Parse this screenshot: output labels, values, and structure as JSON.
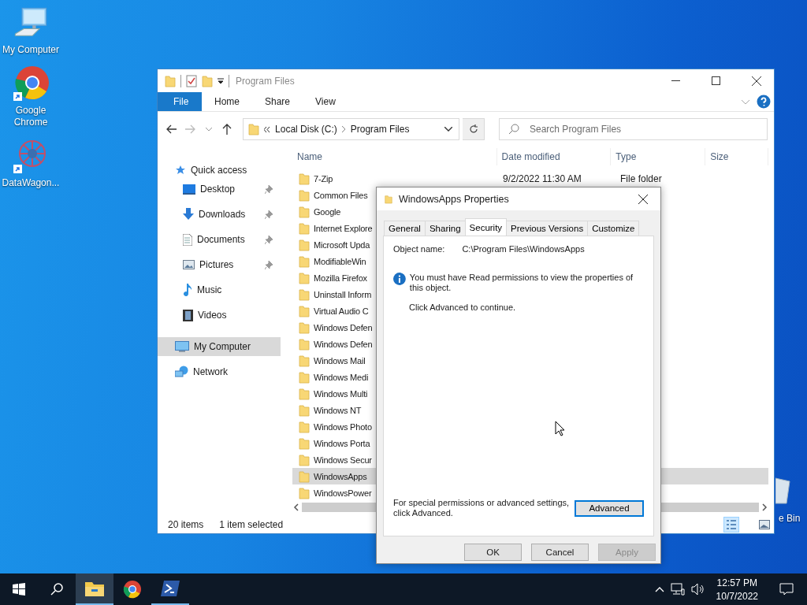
{
  "desktop_icons": [
    {
      "label": "My Computer",
      "kind": "computer"
    },
    {
      "label": "Google Chrome",
      "kind": "chrome"
    },
    {
      "label": "DataWagon...",
      "kind": "emblem"
    }
  ],
  "edge_icon": {
    "label": "e Bin",
    "kind": "bin"
  },
  "explorer": {
    "title": "Program Files",
    "ribbon_tabs": [
      {
        "label": "File",
        "kind": "file"
      },
      {
        "label": "Home",
        "kind": "tab"
      },
      {
        "label": "Share",
        "kind": "tab"
      },
      {
        "label": "View",
        "kind": "tab"
      }
    ],
    "address": [
      "Local Disk (C:)",
      "Program Files"
    ],
    "search": {
      "placeholder": "Search Program Files"
    },
    "nav": [
      {
        "label": "Quick access",
        "kind": "star",
        "selected": false,
        "children": [
          {
            "label": "Desktop",
            "kind": "desktop",
            "pinned": true,
            "selected": false
          },
          {
            "label": "Downloads",
            "kind": "download",
            "pinned": true,
            "selected": false
          },
          {
            "label": "Documents",
            "kind": "document",
            "pinned": true,
            "selected": false
          },
          {
            "label": "Pictures",
            "kind": "picture",
            "pinned": true,
            "selected": false
          },
          {
            "label": "Music",
            "kind": "music",
            "pinned": false,
            "selected": false
          },
          {
            "label": "Videos",
            "kind": "video",
            "pinned": false,
            "selected": false
          }
        ]
      },
      {
        "label": "My Computer",
        "kind": "computer",
        "selected": true
      },
      {
        "label": "Network",
        "kind": "network",
        "selected": false
      }
    ],
    "columns": [
      "Name",
      "Date modified",
      "Type",
      "Size"
    ],
    "rows": [
      {
        "name": "7-Zip",
        "date": "9/2/2022 11:30 AM",
        "type": "File folder",
        "selected": false
      },
      {
        "name": "Common Files",
        "selected": false
      },
      {
        "name": "Google",
        "selected": false
      },
      {
        "name": "Internet Explore",
        "selected": false
      },
      {
        "name": "Microsoft Upda",
        "selected": false
      },
      {
        "name": "ModifiableWin",
        "selected": false
      },
      {
        "name": "Mozilla Firefox",
        "selected": false
      },
      {
        "name": "Uninstall Inform",
        "selected": false
      },
      {
        "name": "Virtual Audio C",
        "selected": false
      },
      {
        "name": "Windows Defen",
        "selected": false
      },
      {
        "name": "Windows Defen",
        "selected": false
      },
      {
        "name": "Windows Mail",
        "selected": false
      },
      {
        "name": "Windows Medi",
        "selected": false
      },
      {
        "name": "Windows Multi",
        "selected": false
      },
      {
        "name": "Windows NT",
        "selected": false
      },
      {
        "name": "Windows Photo",
        "selected": false
      },
      {
        "name": "Windows Porta",
        "selected": false
      },
      {
        "name": "Windows Secur",
        "selected": false
      },
      {
        "name": "WindowsApps",
        "selected": true
      },
      {
        "name": "WindowsPower",
        "selected": false
      }
    ],
    "status": [
      "20 items",
      "1 item selected"
    ],
    "views": [
      {
        "kind": "details",
        "selected": true
      },
      {
        "kind": "thumbnails",
        "selected": false
      }
    ]
  },
  "dialog": {
    "title": "WindowsApps Properties",
    "tabs": [
      {
        "label": "General",
        "selected": false
      },
      {
        "label": "Sharing",
        "selected": false
      },
      {
        "label": "Security",
        "selected": true
      },
      {
        "label": "Previous Versions",
        "selected": false
      },
      {
        "label": "Customize",
        "selected": false
      }
    ],
    "object_label": "Object name:",
    "object_value": "C:\\Program Files\\WindowsApps",
    "info": "You must have Read permissions to view the properties of this object.",
    "hint": "Click Advanced to continue.",
    "advanced_text": "For special permissions or advanced settings, click Advanced.",
    "advanced_button": "Advanced",
    "buttons": [
      {
        "label": "OK",
        "disabled": false
      },
      {
        "label": "Cancel",
        "disabled": false
      },
      {
        "label": "Apply",
        "disabled": true
      }
    ]
  },
  "taskbar": {
    "apps": [
      {
        "kind": "explorer",
        "selected": true,
        "running": true
      },
      {
        "kind": "chrome",
        "selected": false,
        "running": false
      },
      {
        "kind": "terminal",
        "selected": false,
        "running": true
      }
    ],
    "time": "12:57 PM",
    "date": "10/7/2022"
  }
}
